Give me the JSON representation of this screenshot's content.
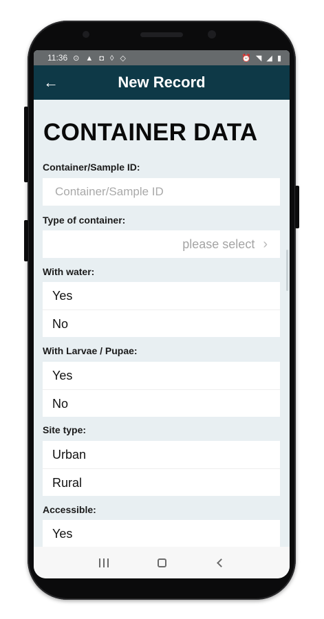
{
  "status_bar": {
    "time": "11:36",
    "left_icons": "⊙ ▲ ◘ ◊ ◇",
    "right_icons": "⏰ ◥ ◢ ▮"
  },
  "app_bar": {
    "title": "New Record",
    "back_icon": "arrow-left-icon"
  },
  "page": {
    "heading": "CONTAINER DATA"
  },
  "form": {
    "sample_id": {
      "label": "Container/Sample ID:",
      "placeholder": "Container/Sample ID",
      "value": ""
    },
    "container_type": {
      "label": "Type of container:",
      "placeholder": "please select",
      "chevron": "›"
    },
    "with_water": {
      "label": "With water:",
      "options": [
        "Yes",
        "No"
      ]
    },
    "larvae_pupae": {
      "label": "With Larvae / Pupae:",
      "options": [
        "Yes",
        "No"
      ]
    },
    "site_type": {
      "label": "Site type:",
      "options": [
        "Urban",
        "Rural"
      ]
    },
    "accessible": {
      "label": "Accessible:",
      "options": [
        "Yes"
      ]
    }
  },
  "nav_bar": {
    "recents_icon": "recents-icon",
    "home_icon": "home-icon",
    "back_icon": "back-nav-icon"
  }
}
